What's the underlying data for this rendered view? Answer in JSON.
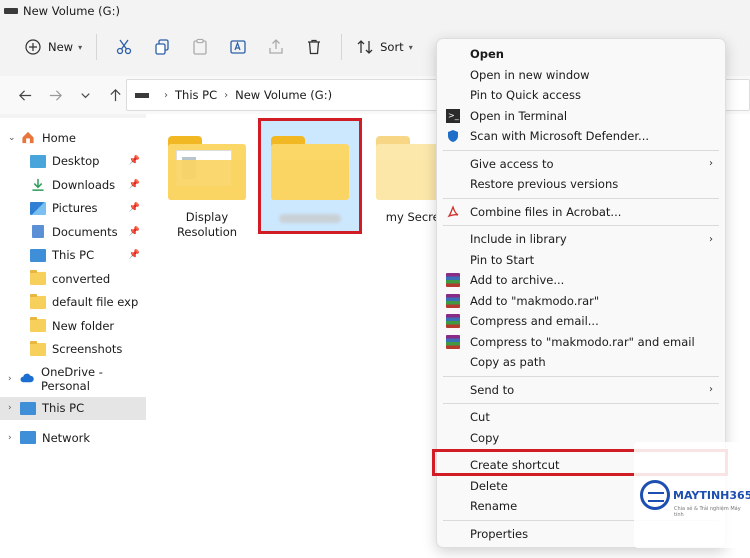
{
  "window": {
    "title": "New Volume (G:)"
  },
  "toolbar": {
    "new_label": "New",
    "sort_label": "Sort"
  },
  "address": {
    "crumbs": [
      "This PC",
      "New Volume (G:)"
    ]
  },
  "sidebar": {
    "home": "Home",
    "items": [
      {
        "label": "Desktop",
        "icon": "desktop-icon",
        "pinned": true
      },
      {
        "label": "Downloads",
        "icon": "downloads-icon",
        "pinned": true
      },
      {
        "label": "Pictures",
        "icon": "pictures-icon",
        "pinned": true
      },
      {
        "label": "Documents",
        "icon": "documents-icon",
        "pinned": true
      },
      {
        "label": "This PC",
        "icon": "this-pc-icon",
        "pinned": true
      },
      {
        "label": "converted",
        "icon": "folder-icon"
      },
      {
        "label": "default file exp",
        "icon": "folder-icon"
      },
      {
        "label": "New folder",
        "icon": "folder-icon"
      },
      {
        "label": "Screenshots",
        "icon": "folder-icon"
      }
    ],
    "onedrive": "OneDrive - Personal",
    "thispc": "This PC",
    "network": "Network"
  },
  "files": [
    {
      "name": "Display Resolution"
    },
    {
      "name": ""
    },
    {
      "name": "my Secret"
    }
  ],
  "context_menu": {
    "items": [
      "Open",
      "Open in new window",
      "Pin to Quick access",
      "Open in Terminal",
      "Scan with Microsoft Defender...",
      "Give access to",
      "Restore previous versions",
      "Combine files in Acrobat...",
      "Include in library",
      "Pin to Start",
      "Add to archive...",
      "Add to \"makmodo.rar\"",
      "Compress and email...",
      "Compress to \"makmodo.rar\" and email",
      "Copy as path",
      "Send to",
      "Cut",
      "Copy",
      "Create shortcut",
      "Delete",
      "Rename",
      "Properties"
    ]
  },
  "watermark": {
    "brand": "MAYTINH365",
    "tagline": "Chia sẻ & Trải nghiệm Máy tính"
  },
  "colors": {
    "highlight": "#d11c25",
    "selection": "#cce8ff",
    "folder": "#fbd768"
  }
}
